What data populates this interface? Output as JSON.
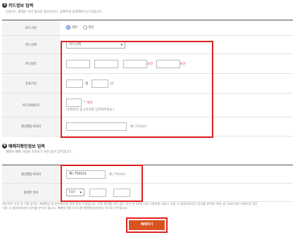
{
  "card_section": {
    "number": "3",
    "title": "카드정보 입력",
    "description": "신용카드 결제로 하려 필요한 정보이니다. 정확하게 입력해주시기 바랍니다.",
    "rows": {
      "card_type": {
        "label": "카드구분",
        "options": [
          "개인",
          "법인"
        ],
        "selected": "개인"
      },
      "card_company": {
        "label": "카드선택",
        "selected": "카드선택"
      },
      "card_number": {
        "label": "카드번호",
        "required_note_1": "보안",
        "required_note_2": "보안"
      },
      "expiry": {
        "label": "유효기간",
        "month_unit": "월",
        "year_unit": "년"
      },
      "password": {
        "label": "카드비밀번호",
        "mask": "**",
        "required_note": "보안",
        "hint": "(비밀번호 앞 2자리를 입력해주세요.)"
      },
      "birth": {
        "label": "생년월일 6자리",
        "example": "예) 750101"
      }
    }
  },
  "reserver_section": {
    "number": "4",
    "title": "예매자확인정보 입력",
    "description": "예매자 예매 사항을 조회하기 위한 정보 입력입니다.",
    "rows": {
      "birth": {
        "label": "생년월일 6자리",
        "value": "예) 750101",
        "example": "예) 750101"
      },
      "phone": {
        "label": "휴대폰 번호",
        "prefix": "010"
      }
    }
  },
  "notes": [
    "개인정보 수집 및 이용 동의는 예매확인 및 본인확인을 위한 정보 수집입니다. 이용 동의를 하지 않는 경우 만 14세 이상 이용자만 서비스 이용 시 법정대리인의 동의를 받아야 하며, 만 14세 미만 이용자의 경우",
    "이용 시 법정대리인의 동의를 받아야 합니다. 예매하기를 누르시면 예매에 동의하신 것으로 간주됩니다."
  ],
  "submit_label": "예매하기",
  "colors": {
    "highlight_border": "#e02020",
    "submit_bg": "#d9531e",
    "radio_accent": "#2b63c6"
  }
}
